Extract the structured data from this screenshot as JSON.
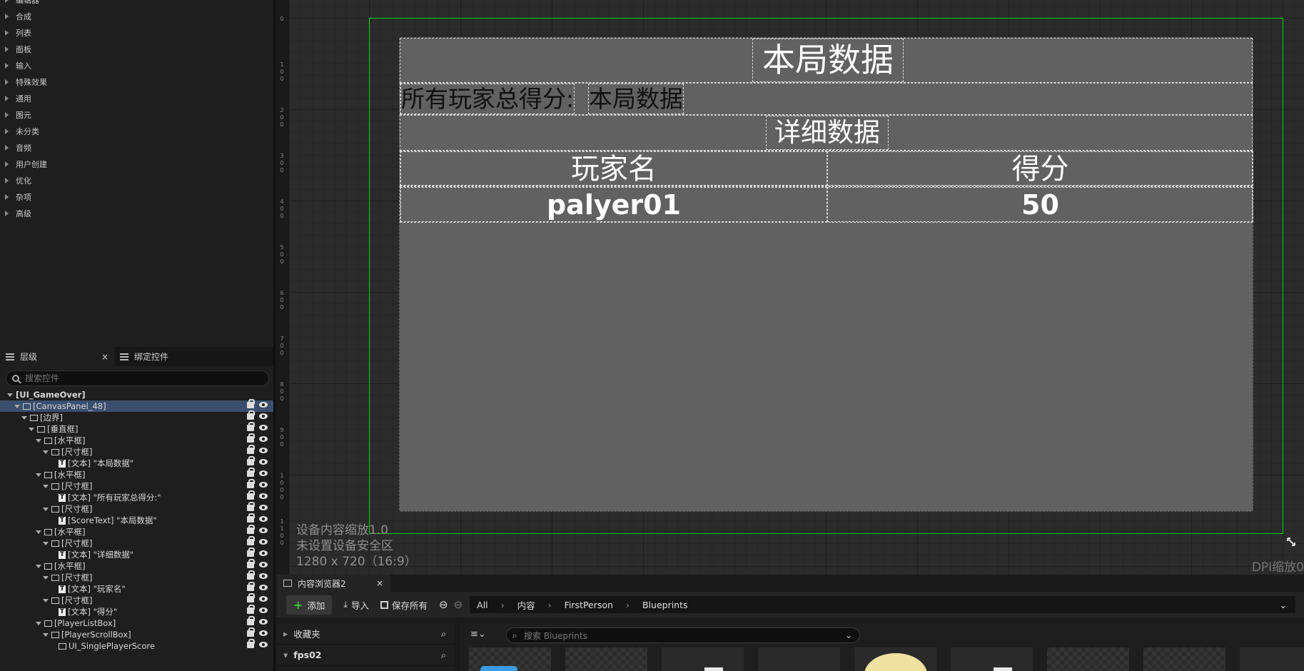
{
  "palette": {
    "items": [
      "编辑器",
      "合成",
      "列表",
      "面板",
      "输入",
      "特殊效果",
      "通用",
      "图元",
      "未分类",
      "音频",
      "用户创建",
      "优化",
      "杂项",
      "高级"
    ]
  },
  "hierarchy": {
    "tab_label": "层级",
    "tab2_label": "绑定控件",
    "search_placeholder": "搜索控件",
    "rows": [
      {
        "label": "[UI_GameOver]",
        "indent": 0
      },
      {
        "label": "[CanvasPanel_48]",
        "indent": 1
      },
      {
        "label": "[边界]",
        "indent": 2
      },
      {
        "label": "[垂直框]",
        "indent": 3
      },
      {
        "label": "[水平框]",
        "indent": 4
      },
      {
        "label": "[尺寸框]",
        "indent": 5
      },
      {
        "label": "[文本] \"本局数据\"",
        "indent": 6
      },
      {
        "label": "[水平框]",
        "indent": 4
      },
      {
        "label": "[尺寸框]",
        "indent": 5
      },
      {
        "label": "[文本] \"所有玩家总得分:\"",
        "indent": 6
      },
      {
        "label": "[尺寸框]",
        "indent": 5
      },
      {
        "label": "[ScoreText] \"本局数据\"",
        "indent": 6
      },
      {
        "label": "[水平框]",
        "indent": 4
      },
      {
        "label": "[尺寸框]",
        "indent": 5
      },
      {
        "label": "[文本] \"详细数据\"",
        "indent": 6
      },
      {
        "label": "[水平框]",
        "indent": 4
      },
      {
        "label": "[尺寸框]",
        "indent": 5
      },
      {
        "label": "[文本] \"玩家名\"",
        "indent": 6
      },
      {
        "label": "[尺寸框]",
        "indent": 5
      },
      {
        "label": "[文本] \"得分\"",
        "indent": 6
      },
      {
        "label": "[PlayerListBox]",
        "indent": 4
      },
      {
        "label": "[PlayerScrollBox]",
        "indent": 5
      },
      {
        "label": "UI_SinglePlayerScore",
        "indent": 6
      }
    ]
  },
  "ruler": {
    "marks": [
      "0",
      "100",
      "200",
      "300",
      "400",
      "500",
      "600",
      "700",
      "800",
      "900",
      "1000",
      "1100"
    ]
  },
  "design": {
    "title": "本局数据",
    "total_label": "所有玩家总得分:",
    "score_text": "本局数据",
    "detail_title": "详细数据",
    "col_name": "玩家名",
    "col_score": "得分",
    "player_name": "palyer01",
    "player_score": "50",
    "info_line1": "设备内容缩放1.0",
    "info_line2": "未设置设备安全区",
    "info_line3": "1280 x 720（16:9）",
    "dpi_label": "DPI缩放0"
  },
  "content_browser": {
    "tab_label": "内容浏览器2",
    "add_label": "添加",
    "import_label": "导入",
    "save_all_label": "保存所有",
    "breadcrumb": [
      "All",
      "内容",
      "FirstPerson",
      "Blueprints"
    ],
    "favorites_label": "收藏夹",
    "project_label": "fps02",
    "search_placeholder": "搜索 Blueprints"
  },
  "colors": {
    "accent_green": "#00d400",
    "selection_blue": "#3a4f6e",
    "panel_gray": "#616161"
  }
}
